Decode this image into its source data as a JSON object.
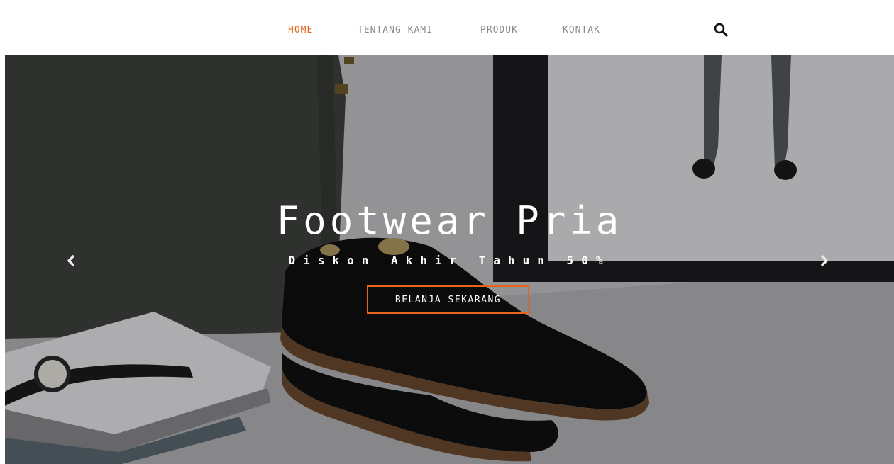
{
  "nav": {
    "items": [
      {
        "label": "HOME",
        "active": true
      },
      {
        "label": "TENTANG KAMI",
        "active": false
      },
      {
        "label": "PRODUK",
        "active": false
      },
      {
        "label": "KONTAK",
        "active": false
      }
    ],
    "search_icon": "search-icon"
  },
  "hero": {
    "title": "Footwear Pria",
    "subtitle": "Diskon Akhir Tahun 50%",
    "cta_label": "BELANJA SEKARANG",
    "prev_icon": "chevron-left-icon",
    "next_icon": "chevron-right-icon"
  },
  "colors": {
    "accent": "#e8641a",
    "nav_text": "#8a8a8a",
    "hero_text": "#ffffff"
  }
}
